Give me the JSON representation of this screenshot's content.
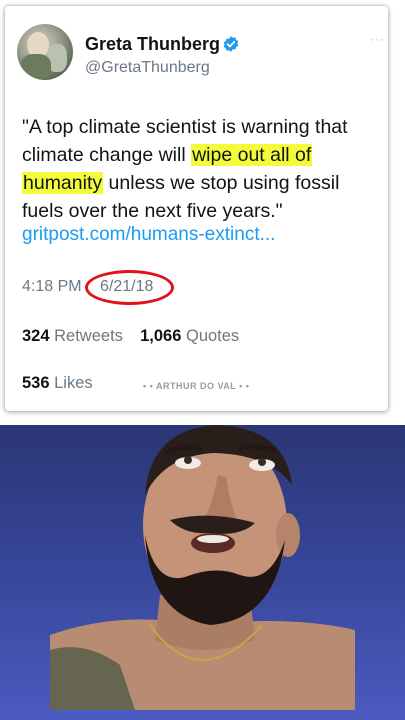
{
  "tweet": {
    "author_name": "Greta Thunberg",
    "author_handle": "@GretaThunberg",
    "more_icon": "more-dots-icon",
    "verified_icon": "verified-badge-icon",
    "text_part1": "\"A top climate scientist is warning that climate change will ",
    "text_highlight1": "wipe out all of",
    "text_part2": " ",
    "text_highlight2": "humanity",
    "text_part3": " unless we stop using fossil fuels over the next five years.\"",
    "link": "gritpost.com/humans-extinct...",
    "time": "4:18 PM",
    "date": "6/21/18",
    "retweets_count": "324",
    "retweets_label": "Retweets",
    "quotes_count": "1,066",
    "quotes_label": "Quotes",
    "likes_count": "536",
    "likes_label": "Likes",
    "watermark": "• • ARTHUR DO VAL • •"
  },
  "colors": {
    "highlight": "#f4fb3a",
    "link": "#1d9bf0",
    "circle_annotation": "#e0121b",
    "verified": "#1d9bf0",
    "background_gradient_top": "#2a3674",
    "background_gradient_bottom": "#4b5bbf"
  }
}
